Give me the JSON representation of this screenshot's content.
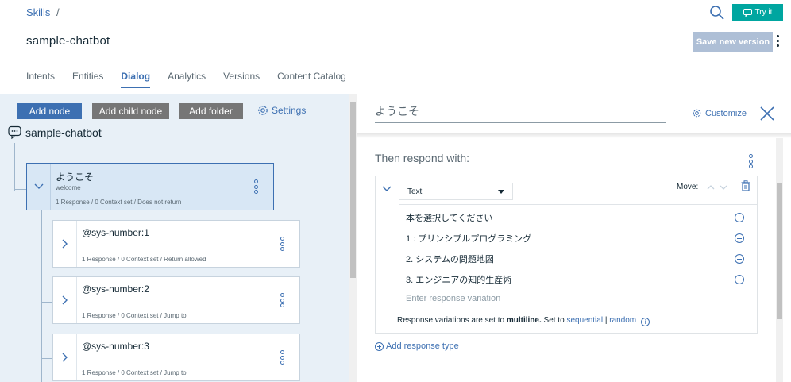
{
  "header": {
    "breadcrumb_link": "Skills",
    "breadcrumb_sep": "/",
    "skill_title": "sample-chatbot",
    "try_label": "Try it",
    "save_label": "Save new version",
    "tabs": [
      {
        "label": "Intents",
        "active": false
      },
      {
        "label": "Entities",
        "active": false
      },
      {
        "label": "Dialog",
        "active": true
      },
      {
        "label": "Analytics",
        "active": false
      },
      {
        "label": "Versions",
        "active": false
      },
      {
        "label": "Content Catalog",
        "active": false
      }
    ]
  },
  "toolbar": {
    "add_node": "Add node",
    "add_child": "Add child node",
    "add_folder": "Add folder",
    "settings": "Settings"
  },
  "tree": {
    "root_label": "sample-chatbot",
    "nodes": [
      {
        "title": "ようこそ",
        "condition": "welcome",
        "meta": "1 Response / 0 Context set / Does not return",
        "selected": true
      },
      {
        "title": "@sys-number:1",
        "condition": "",
        "meta": "1 Response / 0 Context set / Return allowed",
        "selected": false
      },
      {
        "title": "@sys-number:2",
        "condition": "",
        "meta": "1 Response / 0 Context set / Jump to",
        "selected": false
      },
      {
        "title": "@sys-number:3",
        "condition": "",
        "meta": "1 Response / 0 Context set / Jump to",
        "selected": false
      }
    ]
  },
  "editor": {
    "node_name": "ようこそ",
    "customize": "Customize",
    "then_respond": "Then respond with:",
    "response_type": "Text",
    "move_label": "Move:",
    "variations": [
      "本を選択してください",
      "1 : プリンシプルプログラミング",
      "2. システムの問題地図",
      "3. エンジニアの知的生産術"
    ],
    "variation_placeholder": "Enter response variation",
    "note_prefix": "Response variations are set to",
    "note_mode": "multiline.",
    "note_set_to": "Set to",
    "note_sequential": "sequential",
    "note_pipe": "|",
    "note_random": "random",
    "add_response_type": "Add response type"
  },
  "colors": {
    "accent": "#3d70b2",
    "try_button": "#00a6a0",
    "save_button_disabled": "#aebfd6",
    "left_panel_bg": "#e8f0f7",
    "selected_node_bg": "#d8e7f5"
  }
}
